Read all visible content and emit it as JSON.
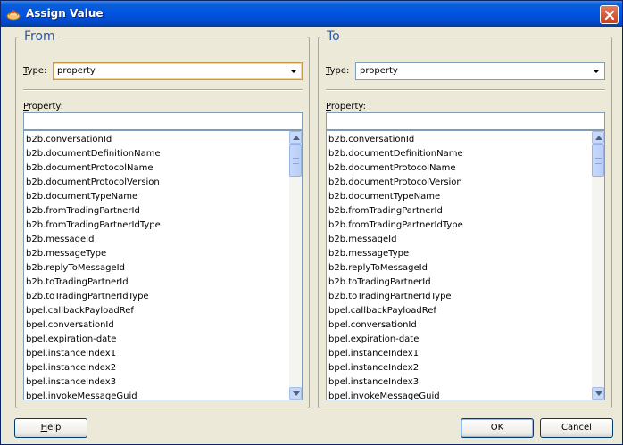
{
  "window": {
    "title": "Assign Value"
  },
  "from": {
    "legend": "From",
    "type_label_ul": "T",
    "type_label_rest": "ype:",
    "type_value": "property",
    "property_label_ul": "P",
    "property_label_rest": "roperty:",
    "property_value": "",
    "items": [
      "b2b.conversationId",
      "b2b.documentDefinitionName",
      "b2b.documentProtocolName",
      "b2b.documentProtocolVersion",
      "b2b.documentTypeName",
      "b2b.fromTradingPartnerId",
      "b2b.fromTradingPartnerIdType",
      "b2b.messageId",
      "b2b.messageType",
      "b2b.replyToMessageId",
      "b2b.toTradingPartnerId",
      "b2b.toTradingPartnerIdType",
      "bpel.callbackPayloadRef",
      "bpel.conversationId",
      "bpel.expiration-date",
      "bpel.instanceIndex1",
      "bpel.instanceIndex2",
      "bpel.instanceIndex3",
      "bpel.invokeMessageGuid"
    ]
  },
  "to": {
    "legend": "To",
    "type_label_ul": "T",
    "type_label_rest": "ype:",
    "type_value": "property",
    "property_label_ul": "P",
    "property_label_rest": "roperty:",
    "property_value": "",
    "items": [
      "b2b.conversationId",
      "b2b.documentDefinitionName",
      "b2b.documentProtocolName",
      "b2b.documentProtocolVersion",
      "b2b.documentTypeName",
      "b2b.fromTradingPartnerId",
      "b2b.fromTradingPartnerIdType",
      "b2b.messageId",
      "b2b.messageType",
      "b2b.replyToMessageId",
      "b2b.toTradingPartnerId",
      "b2b.toTradingPartnerIdType",
      "bpel.callbackPayloadRef",
      "bpel.conversationId",
      "bpel.expiration-date",
      "bpel.instanceIndex1",
      "bpel.instanceIndex2",
      "bpel.instanceIndex3",
      "bpel.invokeMessageGuid"
    ]
  },
  "buttons": {
    "help_ul": "H",
    "help_rest": "elp",
    "ok": "OK",
    "cancel": "Cancel"
  },
  "colors": {
    "legend": "#2a5aa8",
    "titlebar": "#0054e3"
  }
}
